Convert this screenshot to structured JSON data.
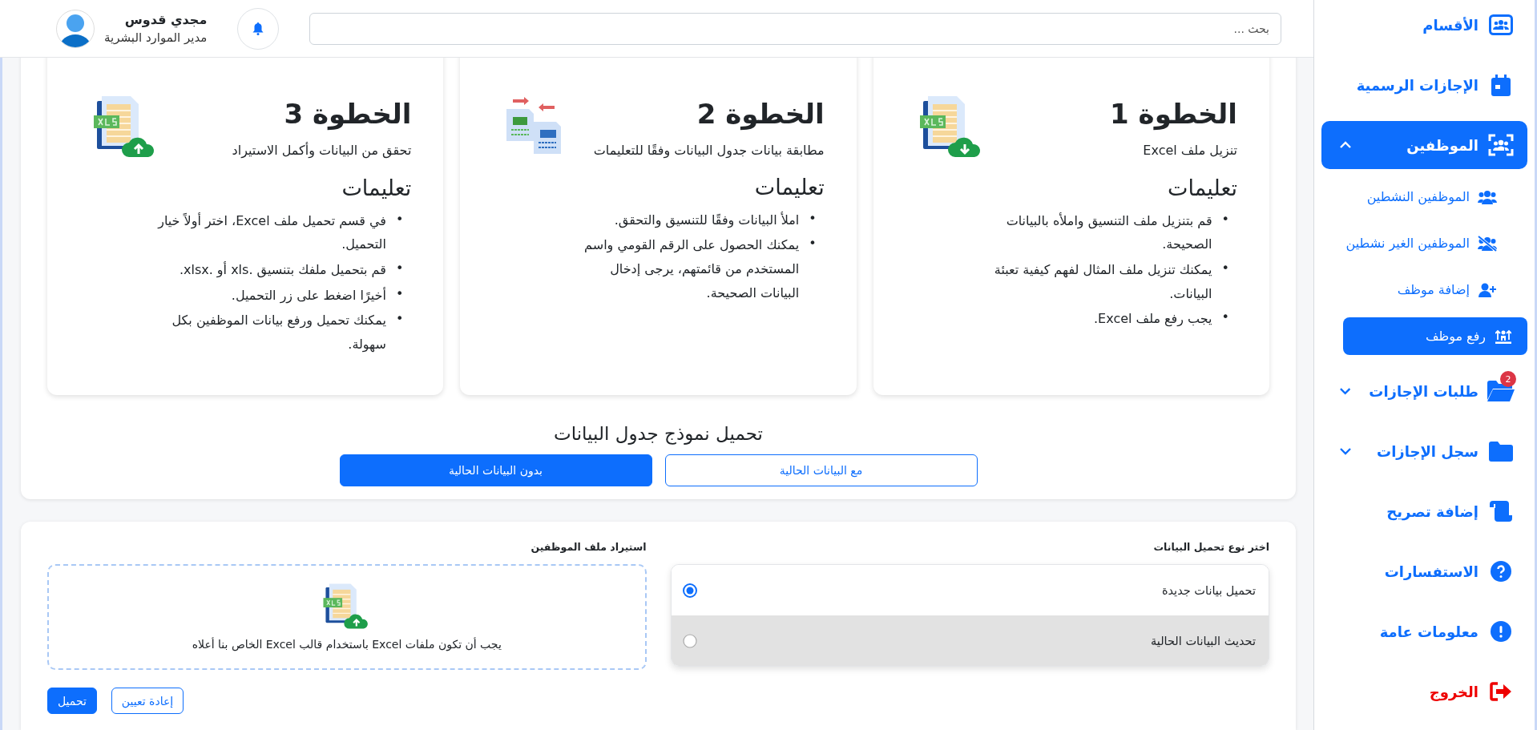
{
  "header": {
    "search": {
      "placeholder": "بحث ..."
    },
    "user": {
      "name": "مجدي قدوس",
      "role": "مدير الموارد البشرية"
    }
  },
  "sidebar": {
    "items": [
      {
        "label": "الأقسام",
        "kind": "link",
        "selected": false
      },
      {
        "label": "الإجازات الرسمية",
        "kind": "link",
        "selected": false
      },
      {
        "label": "الموظفين",
        "kind": "group",
        "selected": true,
        "expanded": true,
        "children": [
          {
            "label": "الموظفين النشطين",
            "selected": false
          },
          {
            "label": "الموظفين الغير نشطين",
            "selected": false
          },
          {
            "label": "إضافة موظف",
            "selected": false
          },
          {
            "label": "رفع موظف",
            "selected": true
          }
        ]
      },
      {
        "label": "طلبات الإجازات",
        "kind": "group",
        "selected": false,
        "expanded": false,
        "badge": "2"
      },
      {
        "label": "سجل الإجازات",
        "kind": "group",
        "selected": false,
        "expanded": false
      },
      {
        "label": "إضافة تصريح",
        "kind": "link",
        "selected": false
      },
      {
        "label": "الاستفسارات",
        "kind": "link",
        "selected": false
      },
      {
        "label": "معلومات عامة",
        "kind": "link",
        "selected": false
      },
      {
        "label": "الخروج",
        "kind": "exit",
        "selected": false
      }
    ]
  },
  "steps": [
    {
      "title": "الخطوة 1",
      "subtitle": "تنزيل ملف Excel",
      "instructions_title": "تعليمات",
      "instructions": [
        {
          "marker": "•",
          "text": "قم بتنزيل ملف التنسيق واملأه بالبيانات الصحيحة."
        },
        {
          "marker": "•",
          "text": "يمكنك تنزيل ملف المثال لفهم كيفية تعبئة البيانات."
        },
        {
          "marker": "•",
          "text": "يجب رفع ملف Excel."
        }
      ]
    },
    {
      "title": "الخطوة 2",
      "subtitle": "مطابقة بيانات جدول البيانات وفقًا للتعليمات",
      "instructions_title": "تعليمات",
      "instructions": [
        {
          "marker": "•",
          "text": "املأ البيانات وفقًا للتنسيق والتحقق."
        },
        {
          "marker": "•",
          "text": "يمكنك الحصول على الرقم القومي واسم المستخدم من قائمتهم، يرجى إدخال البيانات الصحيحة."
        }
      ]
    },
    {
      "title": "الخطوة 3",
      "subtitle": "تحقق من البيانات وأكمل الاستيراد",
      "instructions_title": "تعليمات",
      "instructions": [
        {
          "marker": "•",
          "text": "في قسم تحميل ملف Excel، اختر أولاً خيار التحميل."
        },
        {
          "marker": "•",
          "text": "قم بتحميل ملفك بتنسيق .xls أو .xlsx."
        },
        {
          "marker": "•",
          "text": "أخيرًا اضغط على زر التحميل."
        },
        {
          "marker": "•",
          "text": "يمكنك تحميل ورفع بيانات الموظفين بكل سهولة."
        }
      ]
    }
  ],
  "template": {
    "title": "تحميل نموذج جدول البيانات",
    "buttons": [
      {
        "label": "مع البيانات الحالية",
        "kind": "outline"
      },
      {
        "label": "بدون البيانات الحالية",
        "kind": "primary"
      }
    ]
  },
  "import": {
    "load_type": {
      "label": "اختر نوع تحميل البيانات",
      "options": [
        {
          "label": "تحميل بيانات جديدة",
          "selected": true,
          "hovered": false
        },
        {
          "label": "تحديث البيانات الحالية",
          "selected": false,
          "hovered": true
        }
      ]
    },
    "file": {
      "label": "استيراد ملف الموظفين",
      "hint": "يجب أن تكون ملفات Excel باستخدام قالب Excel الخاص بنا أعلاه"
    },
    "buttons": [
      {
        "label": "إعادة تعيين",
        "kind": "outline"
      },
      {
        "label": "تحميل",
        "kind": "primary"
      }
    ]
  }
}
